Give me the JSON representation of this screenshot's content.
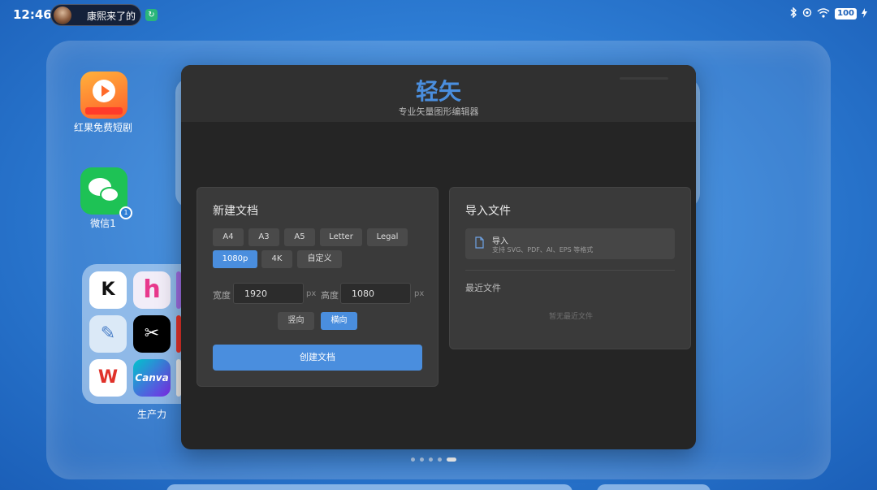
{
  "status_bar": {
    "time": "12:46",
    "notification_text": "康熙来了的",
    "battery": "100"
  },
  "home": {
    "apps": [
      {
        "label": "红果免费短剧"
      },
      {
        "label": "微信1"
      }
    ],
    "folder": {
      "label": "生产力",
      "apps": [
        {
          "glyph": "K"
        },
        {
          "glyph": "h"
        },
        {
          "glyph": "✎"
        },
        {
          "glyph": "✂"
        },
        {
          "glyph": "W"
        },
        {
          "glyph": "Canva"
        }
      ]
    }
  },
  "app": {
    "title": "轻矢",
    "subtitle": "专业矢量图形编辑器",
    "accent_color": "#4a8ede",
    "new_doc": {
      "title": "新建文档",
      "presets_row1": [
        "A4",
        "A3",
        "A5",
        "Letter",
        "Legal"
      ],
      "presets_row2": [
        "1080p",
        "4K",
        "自定义"
      ],
      "selected_preset": "1080p",
      "width_label": "宽度",
      "width_value": "1920",
      "height_label": "高度",
      "height_value": "1080",
      "unit": "px",
      "orientation_portrait": "竖向",
      "orientation_landscape": "横向",
      "selected_orientation": "横向",
      "create_button": "创建文档"
    },
    "import": {
      "title": "导入文件",
      "button_label": "导入",
      "button_sub": "支持 SVG、PDF、AI、EPS 等格式",
      "recent_title": "最近文件",
      "recent_empty": "暂无最近文件"
    }
  }
}
